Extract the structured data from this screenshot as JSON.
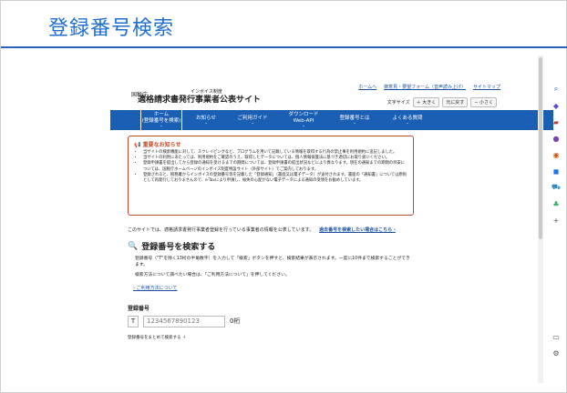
{
  "slide": {
    "title": "登録番号検索"
  },
  "header": {
    "gov_label": "国税庁",
    "invoice_small": "インボイス制度",
    "site_title": "適格請求書発行事業者公表サイト",
    "toplinks": [
      "ホームへ",
      "御意見・要望フォーム（音声読み上げ）",
      "サイトマップ"
    ],
    "font_size_label": "文字サイズ",
    "font_big": "＋ 大きく",
    "font_reset": "元に戻す",
    "font_small": "− 小さく"
  },
  "nav": [
    {
      "label": "ホーム\n(登録番号を検索)"
    },
    {
      "label": "お知らせ"
    },
    {
      "label": "ご利用ガイド"
    },
    {
      "label": "ダウンロード\nWeb-API"
    },
    {
      "label": "登録番号とは"
    },
    {
      "label": "よくある質問"
    }
  ],
  "notice": {
    "title": "重要なお知らせ",
    "items": [
      "当サイトの検索機能に対して、スクレイピングなど、プログラムを用いて記載している情報を取得する行為の禁止事を利用規約に追記しました。",
      "当サイトの利用にあたっては、利用規約をご確認のうえ、取得したデータについては、個人情報保護法に基づき適切にお取り扱いください。",
      "登録申請書を提出してから登録の通知を受けるまでの期間については、登録申請書の提出状況などにより異なります。現在の通知までの期間の目安については、国税庁ホームページのインボイス制度特設サイト（外部サイト）でご案内しております。",
      "登録されると、税務署からインボイスの登録番号等を記載した「登録通知」（書面又は電子データ）が送付されます。書面の「通知書」については原則として再発行しておりませんので、e-Taxにより申請し、紛失の心配がない電子データによる通知の受領をお勧めしています。"
    ]
  },
  "content": {
    "intro": "このサイトでは、適格請求書発行事業者登録を行っている事業者の情報を公表しています。",
    "intro_link": "過去番号を検索したい場合はこちら ›",
    "search_heading": "登録番号を検索する",
    "desc1": "登録番号（\"T\"を除く13桁の半角数字）を入力して「検索」ボタンを押すと、検索結果が表示されます。一度に10件まで検索することができます。",
    "desc2": "検索方法について調べたい場合は、「ご利用方法について」を押してください。",
    "usage_link": "ご利用方法について",
    "field_label": "登録番号",
    "prefix": "T",
    "placeholder": "1234567890123",
    "digits": "0桁",
    "bulk": "登録番号をまとめて検索する ＋"
  }
}
